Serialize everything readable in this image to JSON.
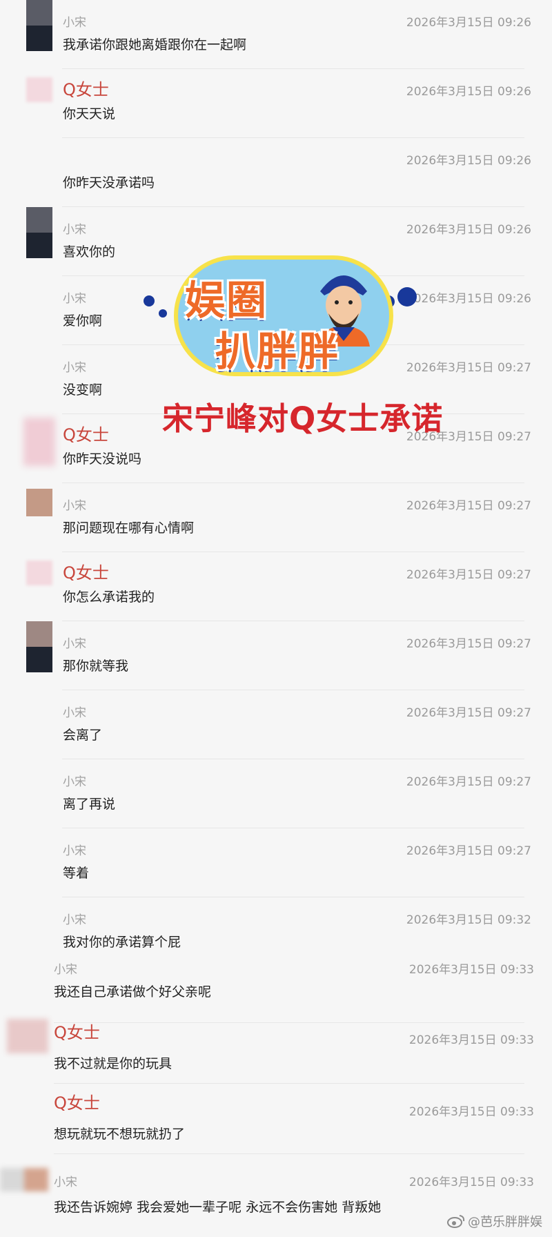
{
  "messages": [
    {
      "sender": "小宋",
      "time": "2026年3月15日 09:26",
      "text": "我承诺你跟她离婚跟你在一起啊"
    },
    {
      "sender": "Q女士",
      "time": "2026年3月15日 09:26",
      "text": "你天天说"
    },
    {
      "sender": "",
      "time": "2026年3月15日 09:26",
      "text": "你昨天没承诺吗"
    },
    {
      "sender": "小宋",
      "time": "2026年3月15日 09:26",
      "text": "喜欢你的"
    },
    {
      "sender": "小宋",
      "time": "2026年3月15日 09:26",
      "text": "爱你啊"
    },
    {
      "sender": "小宋",
      "time": "2026年3月15日 09:27",
      "text": "没变啊"
    },
    {
      "sender": "Q女士",
      "time": "2026年3月15日 09:27",
      "text": "你昨天没说吗"
    },
    {
      "sender": "小宋",
      "time": "2026年3月15日 09:27",
      "text": "那问题现在哪有心情啊"
    },
    {
      "sender": "Q女士",
      "time": "2026年3月15日 09:27",
      "text": "你怎么承诺我的"
    },
    {
      "sender": "小宋",
      "time": "2026年3月15日 09:27",
      "text": "那你就等我"
    },
    {
      "sender": "小宋",
      "time": "2026年3月15日 09:27",
      "text": "会离了"
    },
    {
      "sender": "小宋",
      "time": "2026年3月15日 09:27",
      "text": "离了再说"
    },
    {
      "sender": "小宋",
      "time": "2026年3月15日 09:27",
      "text": "等着"
    },
    {
      "sender": "小宋",
      "time": "2026年3月15日 09:32",
      "text": "我对你的承诺算个屁"
    },
    {
      "sender": "小宋",
      "time": "2026年3月15日 09:33",
      "text": "我还自己承诺做个好父亲呢"
    },
    {
      "sender": "Q女士",
      "time": "2026年3月15日 09:33",
      "text": "我不过就是你的玩具"
    },
    {
      "sender": "Q女士",
      "time": "2026年3月15日 09:33",
      "text": "想玩就玩不想玩就扔了"
    },
    {
      "sender": "小宋",
      "time": "2026年3月15日 09:33",
      "text": "我还告诉婉婷 我会爱她一辈子呢 永远不会伤害她 背叛她"
    }
  ],
  "overlay": {
    "logo_line1": "娱圈",
    "logo_line2": "扒胖胖",
    "caption": "宋宁峰对Q女士承诺"
  },
  "watermark": "@芭乐胖胖娱"
}
